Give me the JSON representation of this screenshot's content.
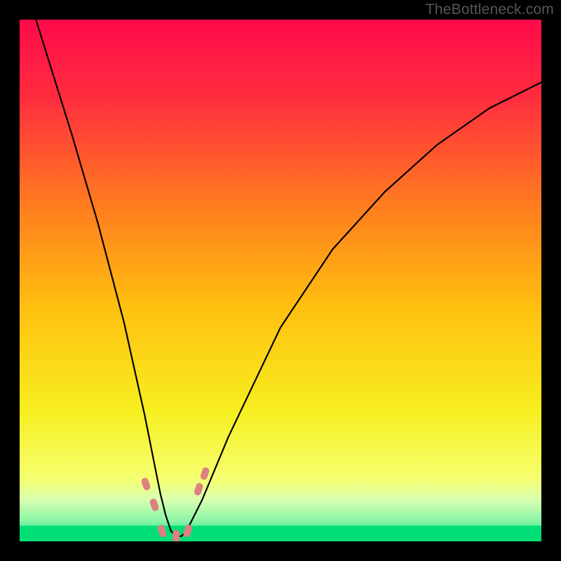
{
  "watermark": "TheBottleneck.com",
  "chart_data": {
    "type": "line",
    "title": "",
    "xlabel": "",
    "ylabel": "",
    "xlim": [
      0,
      100
    ],
    "ylim": [
      0,
      100
    ],
    "axes_visible": false,
    "grid": false,
    "background": "rainbow-vertical-red-to-green",
    "series": [
      {
        "name": "bottleneck-curve",
        "x": [
          0,
          5,
          10,
          15,
          20,
          22,
          24,
          26,
          27,
          28,
          29,
          30,
          31,
          32,
          33,
          35,
          40,
          50,
          60,
          70,
          80,
          90,
          100
        ],
        "values": [
          110,
          94,
          78,
          61,
          42,
          33,
          24,
          14,
          9,
          5,
          2,
          1,
          1,
          2,
          4,
          8,
          20,
          41,
          56,
          67,
          76,
          83,
          88
        ]
      }
    ],
    "markers": [
      {
        "name": "marker-1",
        "x": 24.2,
        "y": 11,
        "color": "#dd8080"
      },
      {
        "name": "marker-2",
        "x": 25.8,
        "y": 7,
        "color": "#dd8080"
      },
      {
        "name": "marker-3",
        "x": 27.3,
        "y": 2,
        "color": "#dd8080"
      },
      {
        "name": "marker-4",
        "x": 30.0,
        "y": 1,
        "color": "#dd8080"
      },
      {
        "name": "marker-5",
        "x": 32.2,
        "y": 2,
        "color": "#dd8080"
      },
      {
        "name": "marker-6",
        "x": 34.3,
        "y": 10,
        "color": "#dd8080"
      },
      {
        "name": "marker-7",
        "x": 35.5,
        "y": 13,
        "color": "#dd8080"
      }
    ],
    "green_band": {
      "y_from": 0,
      "y_to": 3
    },
    "colors": {
      "curve": "#000000",
      "marker": "#dd8080",
      "gradient_stops": [
        {
          "offset": 0.0,
          "color": "#ff0a4a"
        },
        {
          "offset": 0.15,
          "color": "#ff2d3f"
        },
        {
          "offset": 0.35,
          "color": "#ff7a20"
        },
        {
          "offset": 0.55,
          "color": "#ffbf10"
        },
        {
          "offset": 0.75,
          "color": "#f7ef20"
        },
        {
          "offset": 0.88,
          "color": "#f5ff70"
        },
        {
          "offset": 0.92,
          "color": "#d8ffb0"
        },
        {
          "offset": 0.96,
          "color": "#8cf5a8"
        },
        {
          "offset": 1.0,
          "color": "#00e070"
        }
      ]
    }
  }
}
